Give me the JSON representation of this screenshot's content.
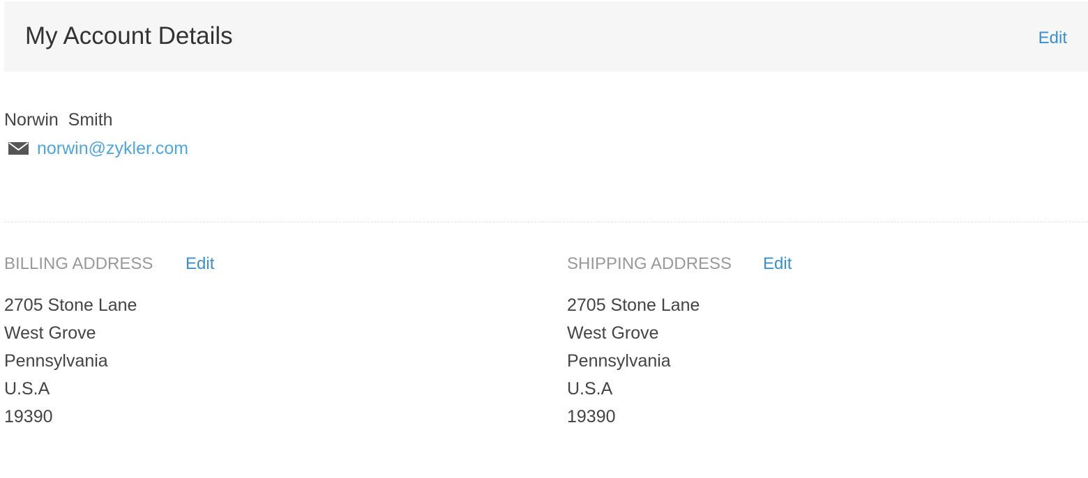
{
  "header": {
    "title": "My Account Details",
    "edit_label": "Edit"
  },
  "profile": {
    "name": "Norwin  Smith",
    "email": "norwin@zykler.com",
    "email_icon": "mail-icon"
  },
  "billing": {
    "label": "BILLING ADDRESS",
    "edit_label": "Edit",
    "street": "2705 Stone Lane",
    "city": "West Grove",
    "state": "Pennsylvania",
    "country": "U.S.A",
    "zip": "19390"
  },
  "shipping": {
    "label": "SHIPPING ADDRESS",
    "edit_label": "Edit",
    "street": "2705 Stone Lane",
    "city": "West Grove",
    "state": "Pennsylvania",
    "country": "U.S.A",
    "zip": "19390"
  },
  "colors": {
    "link": "#3a8fd1",
    "email_link": "#4da6e0",
    "header_bg": "#f6f6f6",
    "label_gray": "#999999",
    "text": "#444444"
  }
}
